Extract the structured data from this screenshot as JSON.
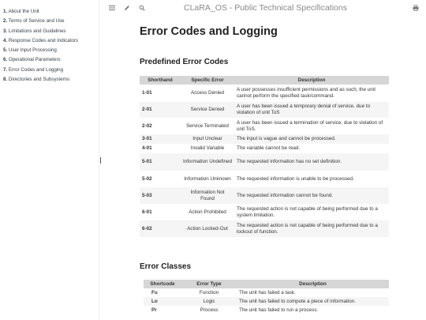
{
  "sidebar": {
    "items": [
      {
        "num": "1.",
        "label": "About the Unit"
      },
      {
        "num": "2.",
        "label": "Terms of Service and Use"
      },
      {
        "num": "3.",
        "label": "Limitations and Guidelines"
      },
      {
        "num": "4.",
        "label": "Response Codes and Indicators"
      },
      {
        "num": "5.",
        "label": "User Input Processing"
      },
      {
        "num": "6.",
        "label": "Operational Parameters"
      },
      {
        "num": "7.",
        "label": "Error Codes and Logging"
      },
      {
        "num": "8.",
        "label": "Directories and Subsystems"
      }
    ]
  },
  "header": {
    "title": "CLaRA_OS - Public Technical Specifications",
    "icons": [
      "menu-icon",
      "edit-icon",
      "search-icon",
      "print-icon"
    ]
  },
  "page": {
    "title": "Error Codes and Logging"
  },
  "error_codes": {
    "title": "Predefined Error Codes",
    "headers": [
      "Shorthand",
      "Specific Error",
      "Description"
    ],
    "rows": [
      {
        "code": "1-01",
        "error": "Access Denied",
        "desc": "A user possesses insufficient permissions and as such, the unit cannot perform the specified task/command."
      },
      {
        "code": "2-01",
        "error": "Service Denied",
        "desc": "A user has been issued a temporary denial of service, due to violation of unit ToS"
      },
      {
        "code": "2-02",
        "error": "Service Terminated",
        "desc": "A user has been issued a termination of service, due to violation of unit ToS."
      },
      {
        "code": "3-01",
        "error": "Input Unclear",
        "desc": "The input is vague and cannot be processed."
      },
      {
        "code": "4-01",
        "error": "Invalid Variable",
        "desc": "The variable cannot be read."
      },
      {
        "code": "5-01",
        "error": "Information Undefined",
        "desc": "The requested information has no set definition."
      },
      {
        "code": "5-02",
        "error": "Information Unknown",
        "desc": "The requested information is unable to be processed."
      },
      {
        "code": "5-03",
        "error": "Information Not Found",
        "desc": "The requested information cannot be found."
      },
      {
        "code": "6-01",
        "error": "Action Prohibited",
        "desc": "The requested action is not capable of being performed due to a system limitation."
      },
      {
        "code": "6-02",
        "error": "Action Locked-Out",
        "desc": "The requested action is not capable of being performed due to a lockout of function."
      }
    ]
  },
  "error_classes": {
    "title": "Error Classes",
    "headers": [
      "Shortcode",
      "Error Type",
      "Description"
    ],
    "rows": [
      {
        "code": "Fu",
        "type": "Function",
        "desc": "The unit has failed a task."
      },
      {
        "code": "Lo",
        "type": "Logic",
        "desc": "The unit has failed to compute a piece of information."
      },
      {
        "code": "Pr",
        "type": "Process",
        "desc": "The unit has failed to run a process."
      }
    ]
  }
}
